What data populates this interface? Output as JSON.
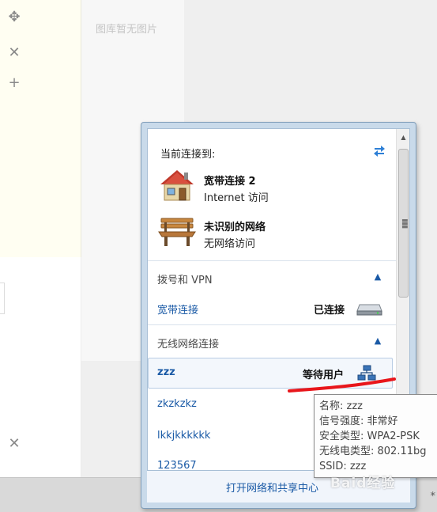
{
  "background": {
    "gallery_empty_text": "图库暂无图片",
    "tools": [
      {
        "icon": "move-icon",
        "glyph": "✥"
      },
      {
        "icon": "close-icon",
        "glyph": "✕"
      },
      {
        "icon": "plus-icon",
        "glyph": "+"
      },
      {
        "icon": "close-icon",
        "glyph": "✕"
      }
    ]
  },
  "flyout": {
    "current_header": "当前连接到:",
    "connections": [
      {
        "name": "宽带连接  2",
        "status": "Internet 访问",
        "icon": "house-icon"
      },
      {
        "name": "未识别的网络",
        "status": "无网络访问",
        "icon": "bench-icon"
      }
    ],
    "dialup_section": {
      "title": "拨号和 VPN",
      "items": [
        {
          "name": "宽带连接",
          "status": "已连接",
          "icon": "modem-icon"
        }
      ]
    },
    "wireless_section": {
      "title": "无线网络连接",
      "items": [
        {
          "name": "zzz",
          "status": "等待用户"
        },
        {
          "name": "zkzkzkz",
          "status": ""
        },
        {
          "name": "lkkjkkkkkk",
          "status": ""
        },
        {
          "name": "123567",
          "status": ""
        }
      ]
    },
    "footer_link": "打开网络和共享中心"
  },
  "tooltip": {
    "lines": [
      "名称: zzz",
      "信号强度: 非常好",
      "安全类型: WPA2-PSK",
      "无线电类型: 802.11bg",
      "SSID: zzz"
    ]
  },
  "watermark": "Baid经验",
  "colors": {
    "link": "#1a5aa6",
    "annotation": "#e8161b",
    "flyout_border": "#c9daea"
  }
}
